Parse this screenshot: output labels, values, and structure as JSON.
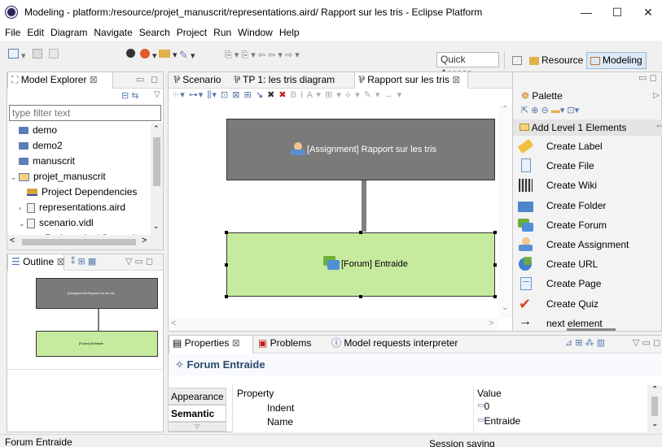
{
  "window": {
    "title": "Modeling - platform:/resource/projet_manuscrit/representations.aird/ Rapport sur les tris - Eclipse Platform",
    "minimize": "—",
    "maximize": "☐",
    "close": "✕"
  },
  "menu": [
    "File",
    "Edit",
    "Diagram",
    "Navigate",
    "Search",
    "Project",
    "Run",
    "Window",
    "Help"
  ],
  "toolbar": {
    "quick_access": "Quick Access",
    "perspective_resource": "Resource",
    "perspective_modeling": "Modeling"
  },
  "model_explorer": {
    "tab": "Model Explorer",
    "filter_placeholder": "type filter text",
    "items": [
      {
        "label": "demo",
        "indent": 0,
        "icon": "folder-icon",
        "twisty": ""
      },
      {
        "label": "demo2",
        "indent": 0,
        "icon": "folder-icon",
        "twisty": ""
      },
      {
        "label": "manuscrit",
        "indent": 0,
        "icon": "folder-icon",
        "twisty": ""
      },
      {
        "label": "projet_manuscrit",
        "indent": 0,
        "icon": "project-icon",
        "twisty": "v"
      },
      {
        "label": "Project Dependencies",
        "indent": 1,
        "icon": "dependencies-icon",
        "twisty": ""
      },
      {
        "label": "representations.aird",
        "indent": 1,
        "icon": "aird-file-icon",
        "twisty": ">"
      },
      {
        "label": "scenario.vidl",
        "indent": 1,
        "icon": "vidl-file-icon",
        "twisty": "v"
      },
      {
        "label": "Pedagogical Scenario",
        "indent": 2,
        "icon": "scenario-icon",
        "twisty": "v"
      }
    ]
  },
  "outline": {
    "tab": "Outline",
    "assignment_label": "[Assignment] Rapport sur les tris",
    "forum_label": "[Forum] Entraide"
  },
  "editor": {
    "tabs": [
      "Scenario",
      "TP 1: les tris diagram",
      "Rapport sur les tris"
    ],
    "nodes": {
      "assignment": "[Assignment]  Rapport sur les tris",
      "forum": "[Forum] Entraide"
    },
    "colors": {
      "assignment_fill": "#7a7a7a",
      "forum_fill": "#c6ea9e",
      "edge": "#7f7f7f"
    }
  },
  "palette": {
    "title": "Palette",
    "group": "Add Level 1 Elements",
    "items": [
      {
        "label": "Create Label",
        "icon": "label-tag-icon"
      },
      {
        "label": "Create File",
        "icon": "file-icon"
      },
      {
        "label": "Create Wiki",
        "icon": "wiki-icon"
      },
      {
        "label": "Create Folder",
        "icon": "folder-icon"
      },
      {
        "label": "Create Forum",
        "icon": "forum-icon"
      },
      {
        "label": "Create Assignment",
        "icon": "assignment-icon"
      },
      {
        "label": "Create URL",
        "icon": "url-globe-icon"
      },
      {
        "label": "Create Page",
        "icon": "page-icon"
      },
      {
        "label": "Create Quiz",
        "icon": "quiz-check-icon"
      },
      {
        "label": "next element",
        "icon": "arrow-right-icon"
      }
    ]
  },
  "properties": {
    "tabs": [
      "Properties",
      "Problems",
      "Model requests interpreter"
    ],
    "header": "Forum Entraide",
    "side_tabs": [
      "Appearance",
      "Semantic"
    ],
    "col_property": "Property",
    "col_value": "Value",
    "rows": [
      {
        "name": "Indent",
        "value": "0"
      },
      {
        "name": "Name",
        "value": "Entraide"
      }
    ]
  },
  "status": {
    "left": "Forum Entraide",
    "center": "Session saving"
  }
}
